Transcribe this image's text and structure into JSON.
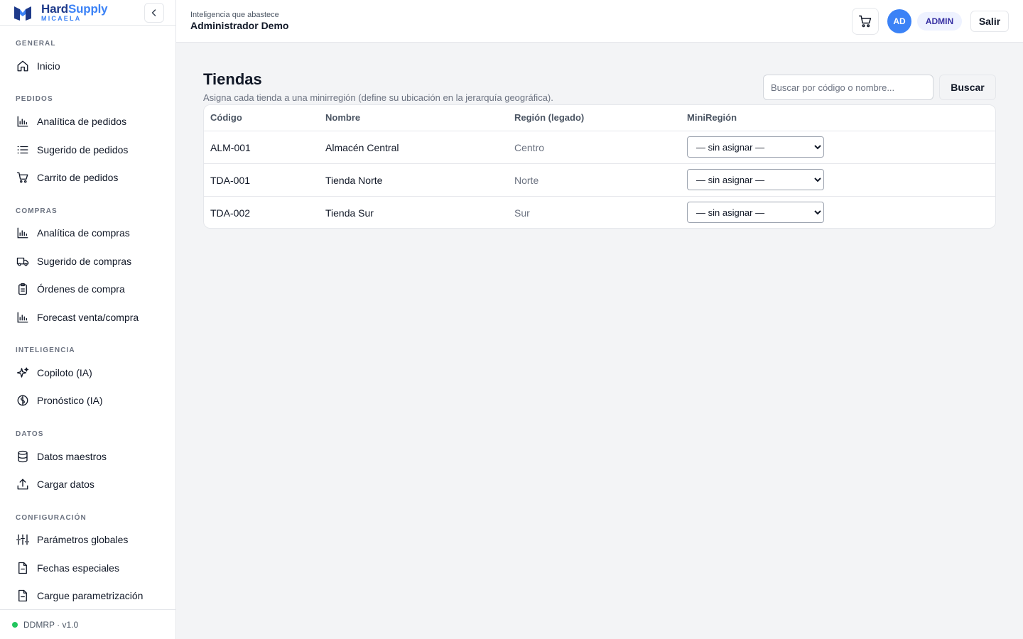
{
  "brand": {
    "name_part1": "Hard",
    "name_part2": "Supply",
    "subtitle": "MICAELA",
    "colors": {
      "primary": "#1e3a8a",
      "accent": "#3b82f6"
    }
  },
  "sidebar": {
    "sections": [
      {
        "title": "GENERAL",
        "items": [
          {
            "label": "Inicio",
            "icon": "home-icon"
          }
        ]
      },
      {
        "title": "PEDIDOS",
        "items": [
          {
            "label": "Analítica de pedidos",
            "icon": "bar-chart-icon"
          },
          {
            "label": "Sugerido de pedidos",
            "icon": "list-icon"
          },
          {
            "label": "Carrito de pedidos",
            "icon": "cart-icon"
          }
        ]
      },
      {
        "title": "COMPRAS",
        "items": [
          {
            "label": "Analítica de compras",
            "icon": "bar-chart-icon"
          },
          {
            "label": "Sugerido de compras",
            "icon": "truck-icon"
          },
          {
            "label": "Órdenes de compra",
            "icon": "clipboard-icon"
          },
          {
            "label": "Forecast venta/compra",
            "icon": "bar-chart-icon"
          }
        ]
      },
      {
        "title": "INTELIGENCIA",
        "items": [
          {
            "label": "Copiloto (IA)",
            "icon": "sparkles-icon"
          },
          {
            "label": "Pronóstico (IA)",
            "icon": "brain-icon"
          }
        ]
      },
      {
        "title": "DATOS",
        "items": [
          {
            "label": "Datos maestros",
            "icon": "database-icon"
          },
          {
            "label": "Cargar datos",
            "icon": "upload-icon"
          }
        ]
      },
      {
        "title": "CONFIGURACIÓN",
        "items": [
          {
            "label": "Parámetros globales",
            "icon": "sliders-icon"
          },
          {
            "label": "Fechas especiales",
            "icon": "file-icon"
          },
          {
            "label": "Cargue parametrización",
            "icon": "file-icon"
          }
        ]
      }
    ],
    "footer": {
      "version": "DDMRP · v1.0",
      "status_color": "#22c55e"
    }
  },
  "header": {
    "subtitle": "Inteligencia que abastece",
    "title": "Administrador Demo",
    "avatar_initials": "AD",
    "role": "ADMIN",
    "logout_label": "Salir"
  },
  "main": {
    "title": "Tiendas",
    "description": "Asigna cada tienda a una minirregión (define su ubicación en la jerarquía geográfica).",
    "search": {
      "placeholder": "Buscar por código o nombre...",
      "value": "",
      "button_label": "Buscar"
    },
    "table": {
      "columns": [
        "Código",
        "Nombre",
        "Región (legado)",
        "MiniRegión"
      ],
      "rows": [
        {
          "codigo": "ALM-001",
          "nombre": "Almacén Central",
          "region": "Centro",
          "miniregion": "— sin asignar —"
        },
        {
          "codigo": "TDA-001",
          "nombre": "Tienda Norte",
          "region": "Norte",
          "miniregion": "— sin asignar —"
        },
        {
          "codigo": "TDA-002",
          "nombre": "Tienda Sur",
          "region": "Sur",
          "miniregion": "— sin asignar —"
        }
      ]
    }
  }
}
